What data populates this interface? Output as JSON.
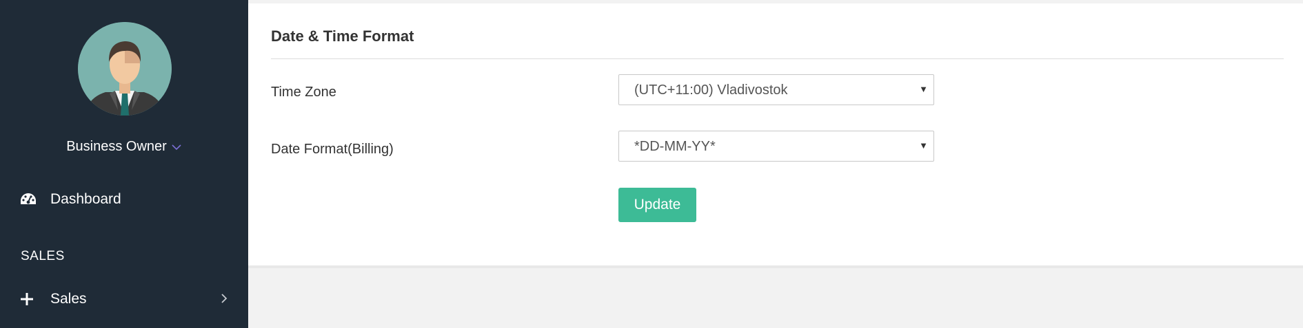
{
  "sidebar": {
    "user_name": "Business Owner",
    "items": [
      {
        "label": "Dashboard",
        "icon": "dashboard-icon"
      },
      {
        "label": "Sales",
        "icon": "plus-icon"
      }
    ],
    "section_sales": "SALES"
  },
  "panel": {
    "title": "Date & Time Format",
    "time_zone_label": "Time Zone",
    "time_zone_value": "(UTC+11:00) Vladivostok",
    "date_format_label": "Date Format(Billing)",
    "date_format_value": "*DD-MM-YY*",
    "update_label": "Update"
  },
  "colors": {
    "sidebar_bg": "#1f2b37",
    "accent": "#3dbb96",
    "avatar_bg": "#7bb3ad"
  }
}
